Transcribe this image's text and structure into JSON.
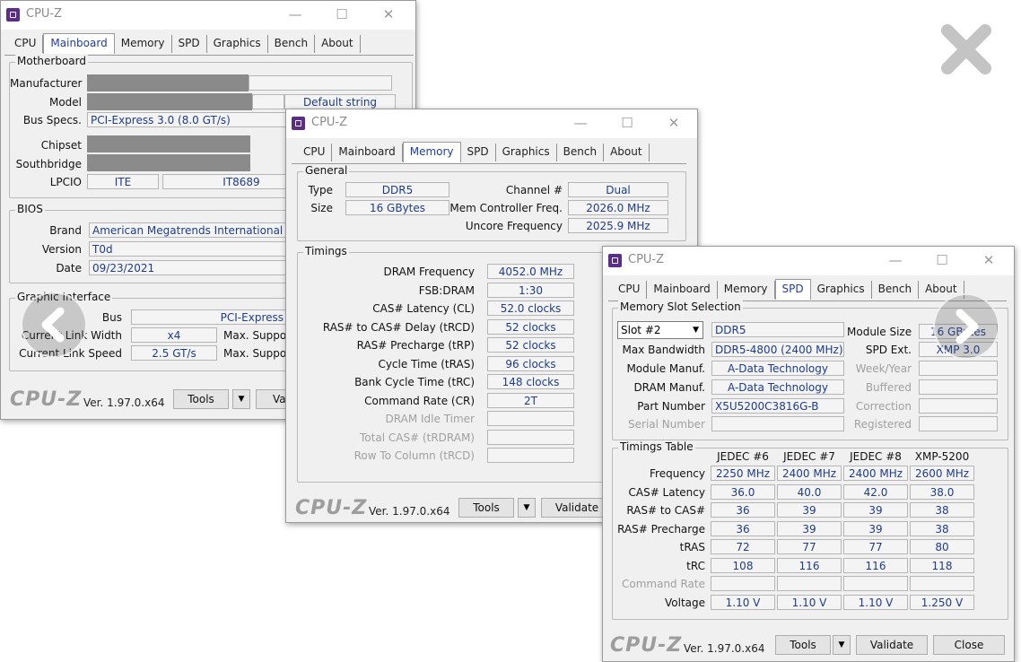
{
  "app_title": "CPU-Z",
  "window_controls": {
    "minimize": "—",
    "maximize": "☐",
    "close": "✕"
  },
  "tabs": [
    "CPU",
    "Mainboard",
    "Memory",
    "SPD",
    "Graphics",
    "Bench",
    "About"
  ],
  "brand": "CPU-Z",
  "version": "Ver. 1.97.0.x64",
  "buttons": {
    "tools": "Tools",
    "validate": "Validate",
    "close": "Close",
    "validate_cut": "Va"
  },
  "mainboard": {
    "motherboard_legend": "Motherboard",
    "manufacturer_label": "Manufacturer",
    "model_label": "Model",
    "model_extra": "Default string",
    "bus_label": "Bus Specs.",
    "bus_value": "PCI-Express 3.0 (8.0 GT/s)",
    "chipset_label": "Chipset",
    "southbridge_label": "Southbridge",
    "lpcio_label": "LPCIO",
    "lpcio_vendor": "ITE",
    "lpcio_model": "IT8689",
    "bios_legend": "BIOS",
    "brand_label": "Brand",
    "brand_value": "American Megatrends International LL",
    "version_label": "Version",
    "version_value": "T0d",
    "date_label": "Date",
    "date_value": "09/23/2021",
    "graphic_legend": "Graphic Interface",
    "gi_bus_label": "Bus",
    "gi_bus_value": "PCI-Express",
    "link_width_label": "Current Link Width",
    "link_width_value": "x4",
    "link_width_max": "Max. Suppo",
    "link_speed_label": "Current Link Speed",
    "link_speed_value": "2.5 GT/s",
    "link_speed_max": "Max. Suppo"
  },
  "memory": {
    "general_legend": "General",
    "type_label": "Type",
    "type_value": "DDR5",
    "size_label": "Size",
    "size_value": "16 GBytes",
    "channel_label": "Channel #",
    "channel_value": "Dual",
    "mcf_label": "Mem Controller Freq.",
    "mcf_value": "2026.0 MHz",
    "uncore_label": "Uncore Frequency",
    "uncore_value": "2025.9 MHz",
    "timings_legend": "Timings",
    "timings": [
      {
        "label": "DRAM Frequency",
        "value": "4052.0 MHz",
        "dim": false
      },
      {
        "label": "FSB:DRAM",
        "value": "1:30",
        "dim": false
      },
      {
        "label": "CAS# Latency (CL)",
        "value": "52.0 clocks",
        "dim": false
      },
      {
        "label": "RAS# to CAS# Delay (tRCD)",
        "value": "52 clocks",
        "dim": false
      },
      {
        "label": "RAS# Precharge (tRP)",
        "value": "52 clocks",
        "dim": false
      },
      {
        "label": "Cycle Time (tRAS)",
        "value": "96 clocks",
        "dim": false
      },
      {
        "label": "Bank Cycle Time (tRC)",
        "value": "148 clocks",
        "dim": false
      },
      {
        "label": "Command Rate (CR)",
        "value": "2T",
        "dim": false
      },
      {
        "label": "DRAM Idle Timer",
        "value": "",
        "dim": true
      },
      {
        "label": "Total CAS# (tRDRAM)",
        "value": "",
        "dim": true
      },
      {
        "label": "Row To Column (tRCD)",
        "value": "",
        "dim": true
      }
    ]
  },
  "spd": {
    "slot_legend": "Memory Slot Selection",
    "slot_selected": "Slot #2",
    "slot_type": "DDR5",
    "module_size_label": "Module Size",
    "module_size_value": "16 GBytes",
    "max_bw_label": "Max Bandwidth",
    "max_bw_value": "DDR5-4800 (2400 MHz)",
    "spd_ext_label": "SPD Ext.",
    "spd_ext_value": "XMP 3.0",
    "module_manuf_label": "Module Manuf.",
    "module_manuf_value": "A-Data Technology",
    "week_year_label": "Week/Year",
    "dram_manuf_label": "DRAM Manuf.",
    "dram_manuf_value": "A-Data Technology",
    "buffered_label": "Buffered",
    "part_label": "Part Number",
    "part_value": "X5U5200C3816G-B",
    "correction_label": "Correction",
    "serial_label": "Serial Number",
    "registered_label": "Registered",
    "timings_legend": "Timings Table",
    "columns": [
      "JEDEC #6",
      "JEDEC #7",
      "JEDEC #8",
      "XMP-5200"
    ],
    "rows": [
      {
        "label": "Frequency",
        "values": [
          "2250 MHz",
          "2400 MHz",
          "2400 MHz",
          "2600 MHz"
        ],
        "dim": false
      },
      {
        "label": "CAS# Latency",
        "values": [
          "36.0",
          "40.0",
          "42.0",
          "38.0"
        ],
        "dim": false
      },
      {
        "label": "RAS# to CAS#",
        "values": [
          "36",
          "39",
          "39",
          "38"
        ],
        "dim": false
      },
      {
        "label": "RAS# Precharge",
        "values": [
          "36",
          "39",
          "39",
          "38"
        ],
        "dim": false
      },
      {
        "label": "tRAS",
        "values": [
          "72",
          "77",
          "77",
          "80"
        ],
        "dim": false
      },
      {
        "label": "tRC",
        "values": [
          "108",
          "116",
          "116",
          "118"
        ],
        "dim": false
      },
      {
        "label": "Command Rate",
        "values": [
          "",
          "",
          "",
          ""
        ],
        "dim": true
      },
      {
        "label": "Voltage",
        "values": [
          "1.10 V",
          "1.10 V",
          "1.10 V",
          "1.250 V"
        ],
        "dim": false
      }
    ]
  }
}
